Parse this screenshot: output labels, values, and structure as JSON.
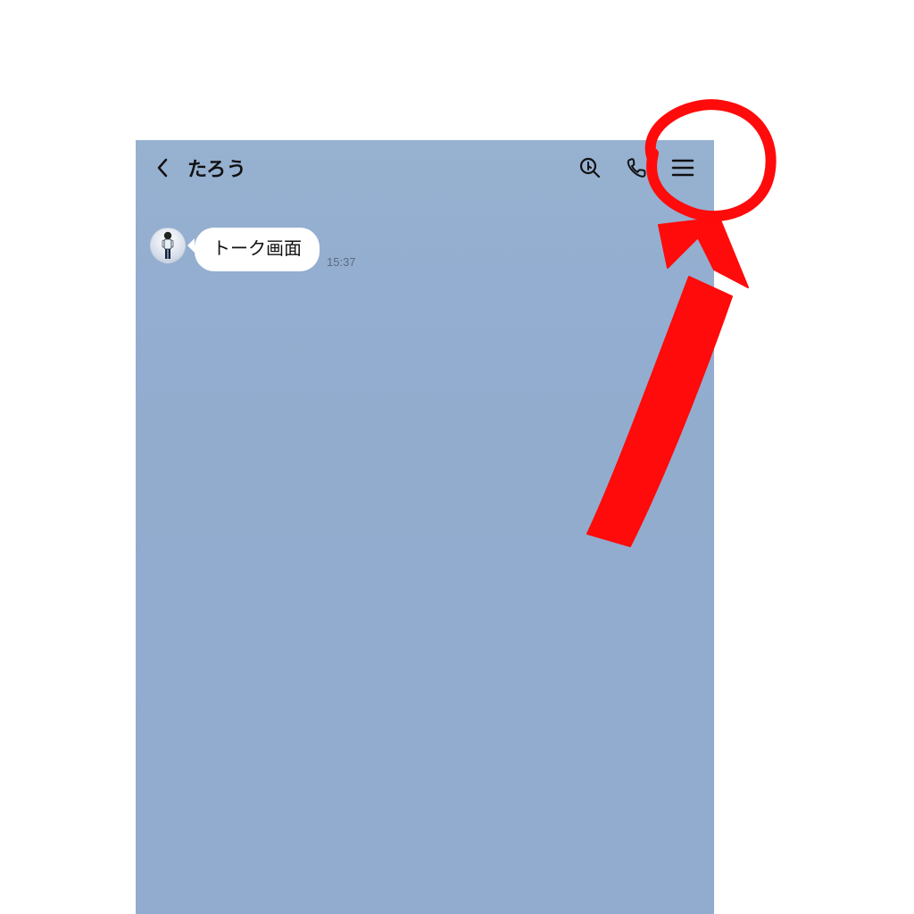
{
  "header": {
    "title": "たろう",
    "icons": {
      "back": "chevron-left-icon",
      "search": "search-icon",
      "call": "phone-icon",
      "menu": "hamburger-menu-icon"
    }
  },
  "messages": [
    {
      "sender": "other",
      "text": "トーク画面",
      "time": "15:37"
    }
  ],
  "annotation": {
    "color": "#ff0b0b",
    "target": "hamburger-menu-icon"
  }
}
